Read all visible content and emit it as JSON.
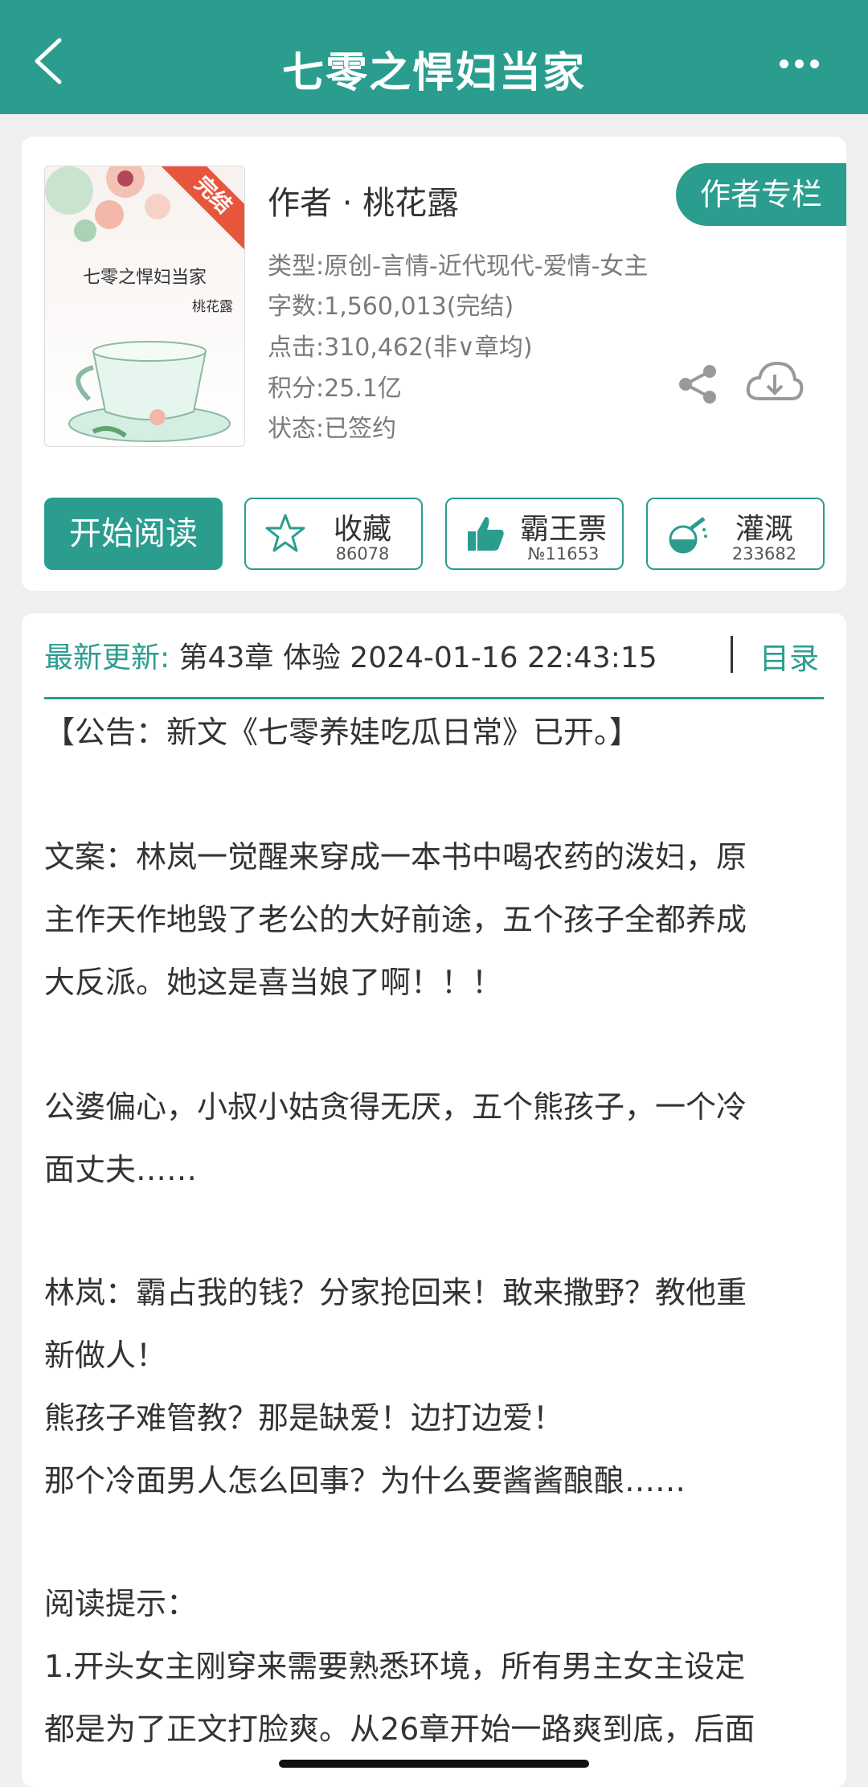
{
  "header": {
    "title": "七零之悍妇当家",
    "back_icon": "chevron-left-icon",
    "more_icon": "more-dots-icon"
  },
  "book": {
    "cover": {
      "badge": "完结",
      "title": "七零之悍妇当家",
      "author": "桃花露"
    },
    "author_line": "作者 · 桃花露",
    "author_column_button": "作者专栏",
    "meta": [
      "类型:原创-言情-近代现代-爱情-女主",
      "字数:1,560,013(完结)",
      "点击:310,462(非∨章均)",
      "积分:25.1亿",
      "状态:已签约"
    ],
    "share_icon": "share-icon",
    "download_icon": "cloud-download-icon"
  },
  "actions": {
    "read": "开始阅读",
    "favorite": {
      "label": "收藏",
      "count": "86078",
      "icon": "star-icon"
    },
    "ticket": {
      "label": "霸王票",
      "count": "№11653",
      "icon": "thumbs-up-icon"
    },
    "water": {
      "label": "灌溉",
      "count": "233682",
      "icon": "watering-flask-icon"
    }
  },
  "update": {
    "label": "最新更新:",
    "value": "第43章 体验 2024-01-16 22:43:15",
    "toc": "目录"
  },
  "intro": [
    "【公告：新文《七零养娃吃瓜日常》已开。】",
    "文案：林岚一觉醒来穿成一本书中喝农药的泼妇，原",
    "主作天作地毁了老公的大好前途，五个孩子全都养成",
    "大反派。她这是喜当娘了啊！！！",
    "公婆偏心，小叔小姑贪得无厌，五个熊孩子，一个冷",
    "面丈夫……",
    "林岚：霸占我的钱？分家抢回来！敢来撒野？教他重",
    "新做人！",
    "熊孩子难管教？那是缺爱！边打边爱！",
    "那个冷面男人怎么回事？为什么要酱酱酿酿……",
    "阅读提示：",
    "1.开头女主刚穿来需要熟悉环境，所有男主女主设定",
    "都是为了正文打脸爽。从26章开始一路爽到底，后面"
  ],
  "colors": {
    "accent": "#2a9d8f",
    "badge": "#e8553d"
  }
}
